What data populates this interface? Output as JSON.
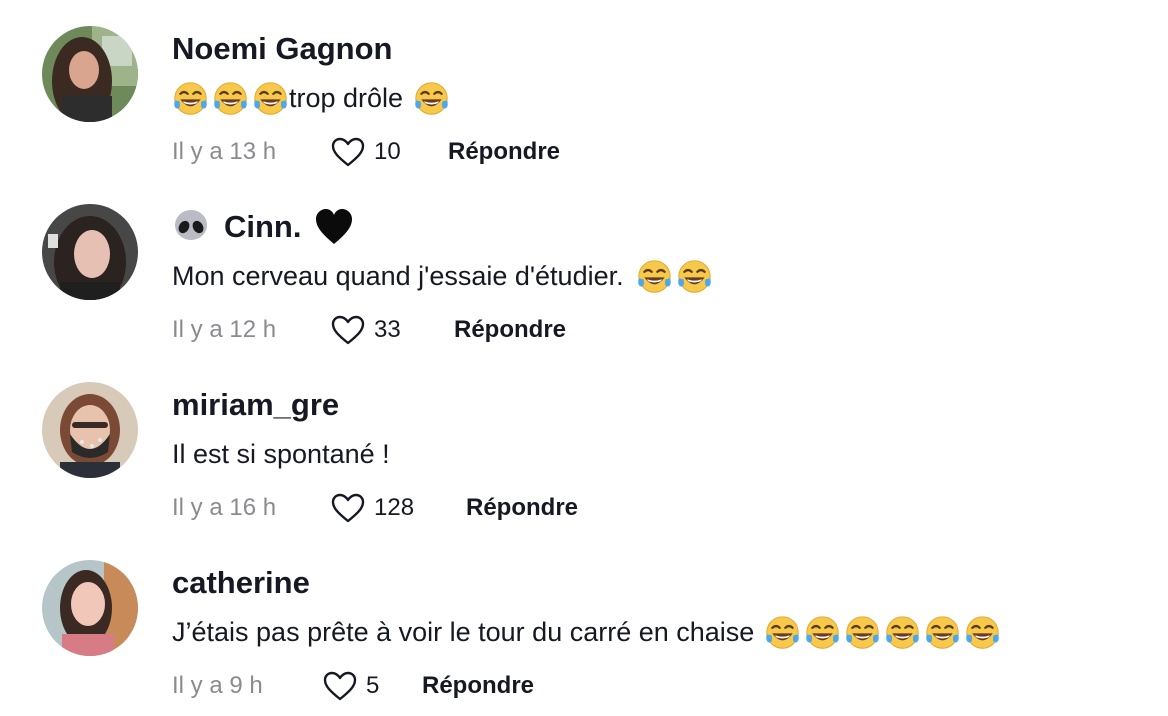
{
  "comments": [
    {
      "username": "Noemi Gagnon",
      "prefix_icon": "",
      "suffix_icon": "",
      "text_before": "",
      "text": "trop drôle",
      "time": "Il y a 13 h",
      "likes": "10",
      "reply_label": "Répondre",
      "avatar_colors": {
        "bg": "#7a8f6a",
        "hair": "#3a2a22",
        "skin": "#d9a58e"
      }
    },
    {
      "username": "Cinn.",
      "prefix_icon": "alien-emoji",
      "suffix_icon": "black-heart-emoji",
      "text": "Mon cerveau quand j'essaie d'étudier.",
      "time": "Il y a 12 h",
      "likes": "33",
      "reply_label": "Répondre",
      "avatar_colors": {
        "bg": "#4a4a4a",
        "hair": "#2b2320",
        "skin": "#e6c0b3"
      }
    },
    {
      "username": "miriam_gre",
      "text": "Il est si spontané !",
      "time": "Il y a 16 h",
      "likes": "128",
      "reply_label": "Répondre",
      "avatar_colors": {
        "bg": "#d6c7b4",
        "hair": "#7a4a35",
        "skin": "#e7c2ad"
      }
    },
    {
      "username": "catherine",
      "text": "J’étais pas prête à voir le tour du carré en chaise",
      "time": "Il y a 9 h",
      "likes": "5",
      "reply_label": "Répondre",
      "avatar_colors": {
        "bg": "#b8c7c9",
        "hair": "#3b2a24",
        "skin": "#f0c7b8"
      }
    }
  ],
  "icons": {
    "laugh_emoji": "face-with-tears-of-joy-icon",
    "like": "heart-outline-icon"
  }
}
